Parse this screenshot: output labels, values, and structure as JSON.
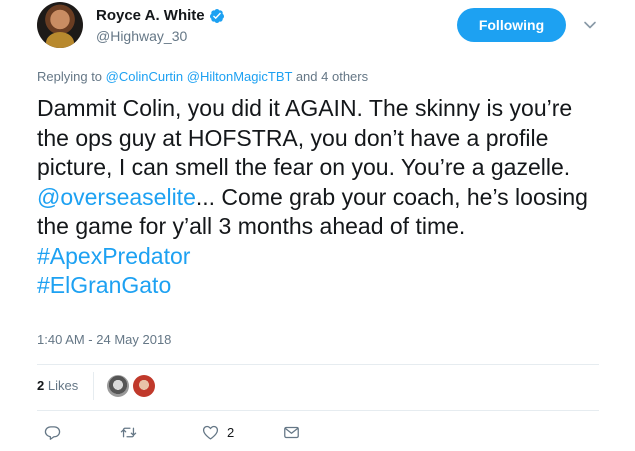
{
  "author": {
    "name": "Royce A. White",
    "handle": "@Highway_30",
    "verified": true
  },
  "follow_button": {
    "label": "Following"
  },
  "reply_context": {
    "prefix": "Replying to ",
    "mention1": "@ColinCurtin",
    "mention2": "@HiltonMagicTBT",
    "suffix": " and 4 others"
  },
  "tweet": {
    "text_part1": "Dammit Colin, you did it AGAIN. The skinny is you’re the ops guy at HOFSTRA, you don’t have a profile picture, I can smell the fear on you. You’re a gazelle. ",
    "mention": "@overseaselite",
    "text_part2": "... Come grab your coach, he’s loosing the game for y’all 3 months ahead of time. ",
    "hashtag1": "#ApexPredator",
    "hashtag2": "#ElGranGato"
  },
  "timestamp": "1:40 AM - 24 May 2018",
  "engagement": {
    "likes_count": "2",
    "likes_label": " Likes"
  },
  "actions": {
    "like_count": "2"
  },
  "colors": {
    "accent": "#1da1f2",
    "secondary_text": "#657786",
    "primary_text": "#14171a",
    "divider": "#e6ecf0"
  },
  "icons": [
    "verified-badge-icon",
    "caret-down-icon",
    "reply-icon",
    "retweet-icon",
    "heart-icon",
    "direct-message-icon"
  ]
}
